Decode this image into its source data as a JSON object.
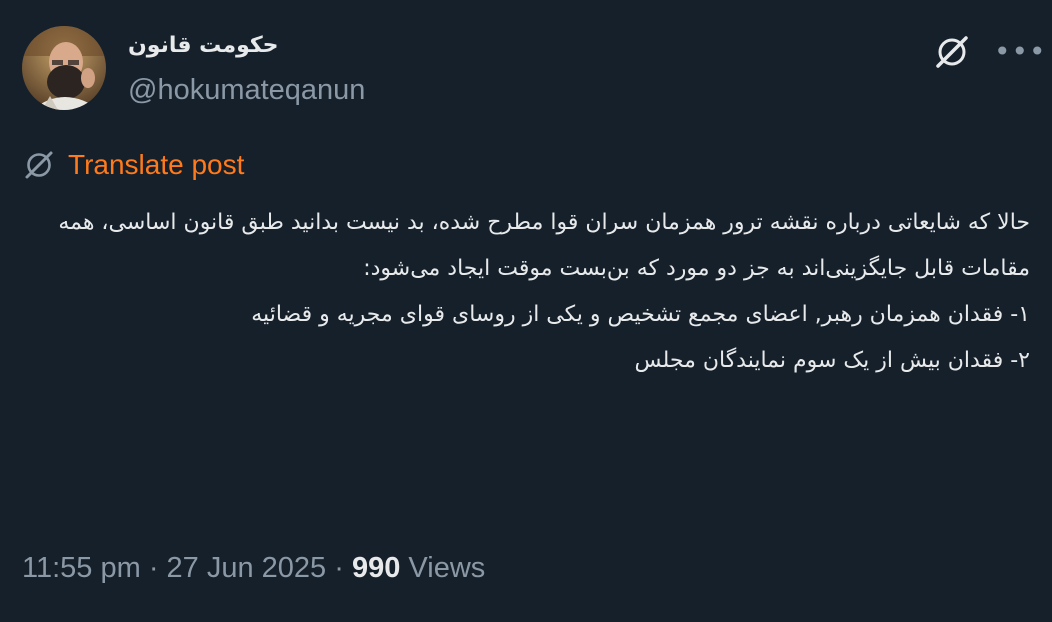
{
  "author": {
    "display_name": "حکومت قانون",
    "handle": "@hokumateqanun"
  },
  "actions": {
    "more_label": "•••"
  },
  "translate": {
    "label": "Translate post"
  },
  "post": {
    "lines": [
      "حالا که شایعاتی درباره نقشه ترور همزمان سران قوا مطرح شده، بد نیست بدانید طبق قانون اساسی، همه مقامات قابل جایگزینی‌اند به جز  دو مورد که بن‌بست موقت ایجاد می‌شود:",
      "۱- فقدان همزمان رهبر, اعضای مجمع تشخیص و یکی از  روسای قوای مجریه و قضائیه",
      "۲- فقدان بیش از یک سوم نمایندگان مجلس"
    ]
  },
  "meta": {
    "time": "11:55 pm",
    "separator1": " · ",
    "date": "27 Jun 2025",
    "separator2": " · ",
    "views_count": "990",
    "views_label": " Views"
  },
  "colors": {
    "background": "#15202b",
    "text": "#e7e9ea",
    "secondary": "#8b98a5",
    "translate": "#ff7a1a"
  }
}
